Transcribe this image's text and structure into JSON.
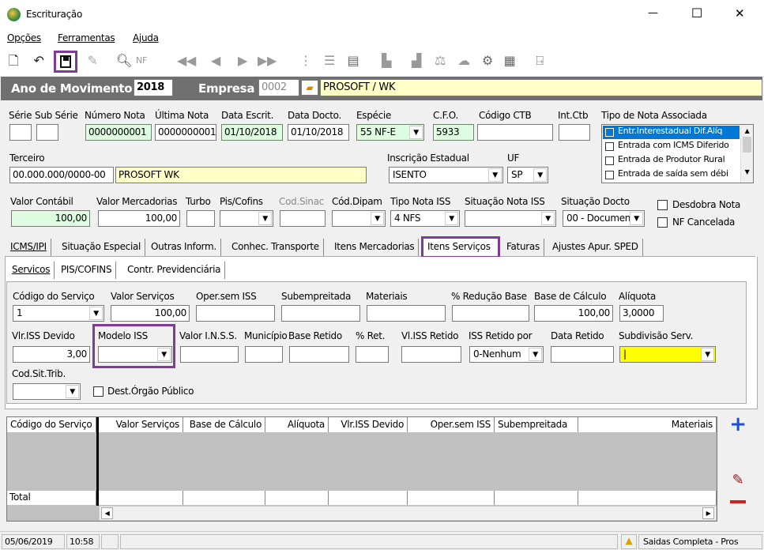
{
  "window": {
    "title": "Escrituração",
    "min": "—",
    "max": "☐",
    "close": "✕"
  },
  "menu": [
    "Opções",
    "Ferramentas",
    "Ajuda"
  ],
  "header": {
    "ano_label": "Ano de Movimento",
    "ano_value": "2018",
    "empresa_label": "Empresa",
    "empresa_code": "0002",
    "empresa_name": "PROSOFT / WK"
  },
  "fields": {
    "serie_l": "Série",
    "subserie_l": "Sub Série",
    "numnota_l": "Número Nota",
    "ultnota_l": "Última Nota",
    "dtesc_l": "Data Escrit.",
    "dtdoc_l": "Data Docto.",
    "especie_l": "Espécie",
    "cfo_l": "C.F.O.",
    "codctb_l": "Código CTB",
    "intctb_l": "Int.Ctb",
    "tiponota_l": "Tipo de Nota Associada",
    "numnota": "0000000001",
    "ultnota": "0000000001",
    "dtesc": "01/10/2018",
    "dtdoc": "01/10/2018",
    "especie": "55  NF-E",
    "cfo": "5933",
    "terceiro_l": "Terceiro",
    "terceiro_code": "00.000.000/0000-00",
    "terceiro_name": "PROSOFT WK",
    "ie_l": "Inscrição Estadual",
    "ie": "ISENTO",
    "uf_l": "UF",
    "uf": "SP",
    "vcont_l": "Valor Contábil",
    "vmerc_l": "Valor Mercadorias",
    "turbo_l": "Turbo",
    "piscof_l": "Pis/Cofins",
    "codsinac_l": "Cod.Sinac",
    "coddipam_l": "Cód.Dipam",
    "tiponiss_l": "Tipo Nota ISS",
    "sitniss_l": "Situação Nota ISS",
    "sitdoc_l": "Situação Docto",
    "vcont": "100,00",
    "vmerc": "100,00",
    "tiponiss": "4   NFS",
    "sitdoc": "00 - Documen",
    "desdobra": "Desdobra Nota",
    "nfcanc": "NF Cancelada"
  },
  "tipo_nota_list": [
    "Entr.Interestadual Dif.Alíq",
    "Entrada com ICMS Diferido",
    "Entrada de Produtor Rural",
    "Entrada de saída sem débi"
  ],
  "tabs": [
    "ICMS/IPI",
    "Situação Especial",
    "Outras Inform.",
    "Conhec. Transporte",
    "Itens Mercadorias",
    "Itens Serviços",
    "Faturas",
    "Ajustes Apur. SPED"
  ],
  "subtabs": [
    "Servicos",
    "PIS/COFINS",
    "Contr. Previdenciária"
  ],
  "servicos": {
    "codserv_l": "Código do Serviço",
    "valserv_l": "Valor Serviços",
    "opersem_l": "Oper.sem ISS",
    "subemp_l": "Subempreitada",
    "mat_l": "Materiais",
    "redbase_l": "% Redução Base",
    "basecalc_l": "Base de Cálculo",
    "aliq_l": "Alíquota",
    "codserv": "1",
    "valserv": "100,00",
    "basecalc": "100,00",
    "aliq": "3,0000",
    "vlissdev_l": "Vlr.ISS Devido",
    "modiss_l": "Modelo ISS",
    "valinss_l": "Valor I.N.S.S.",
    "munic_l": "Município",
    "baseret_l": "Base Retido",
    "pret_l": "% Ret.",
    "vlissret_l": "Vl.ISS Retido",
    "issretpor_l": "ISS Retido por",
    "dtret_l": "Data Retido",
    "subdiv_l": "Subdivisão Serv.",
    "vlissdev": "3,00",
    "issretpor": "0-Nenhum",
    "codsit_l": "Cod.Sit.Trib.",
    "destorg": "Dest.Órgão Público"
  },
  "grid": {
    "headers": [
      "Código do Serviço",
      "Valor Serviços",
      "Base de Cálculo",
      "Alíquota",
      "Vlr.ISS Devido",
      "Oper.sem ISS",
      "Subempreitada",
      "Materiais"
    ],
    "total": "Total"
  },
  "status": {
    "date": "05/06/2019",
    "time": "10:58",
    "msg": "Saidas Completa - Pros"
  },
  "colors": {
    "header_bg": "#707070",
    "highlight": "#7d3c98",
    "green": "#ddfce0",
    "yellow_field": "#ffff00"
  }
}
